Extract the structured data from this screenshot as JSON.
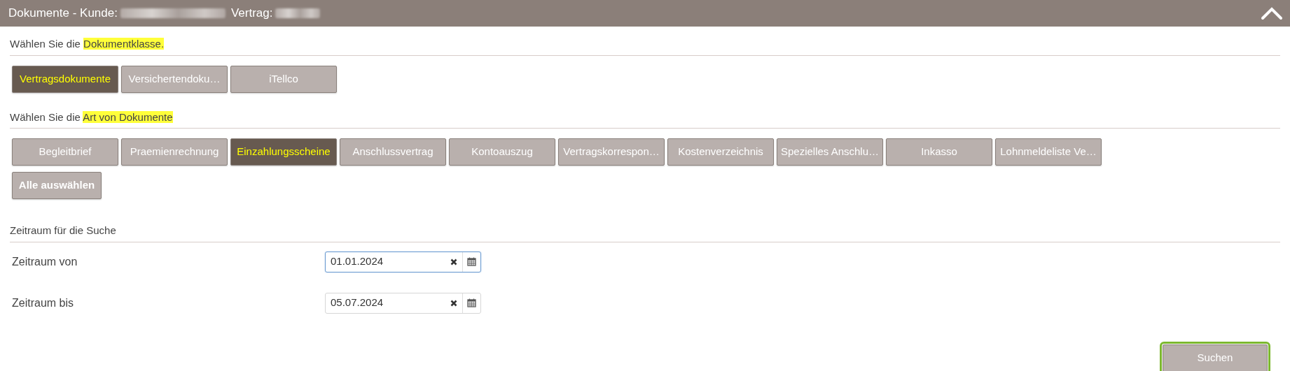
{
  "header": {
    "title_prefix": "Dokumente - Kunde:",
    "contract_label": "Vertrag:",
    "expanded": true
  },
  "document_class": {
    "heading": {
      "text": "Wählen Sie die ",
      "highlight": "Dokumentklasse."
    },
    "buttons": [
      {
        "label": "Vertragsdokumente",
        "selected": true
      },
      {
        "label": "Versichertendoku…",
        "selected": false
      },
      {
        "label": "iTellco",
        "selected": false
      }
    ]
  },
  "document_type": {
    "heading": {
      "text": "Wählen Sie die ",
      "highlight": "Art von Dokumente"
    },
    "buttons": [
      {
        "label": "Begleitbrief",
        "selected": false
      },
      {
        "label": "Praemienrechnung",
        "selected": false
      },
      {
        "label": "Einzahlungsscheine",
        "selected": true
      },
      {
        "label": "Anschlussvertrag",
        "selected": false
      },
      {
        "label": "Kontoauszug",
        "selected": false
      },
      {
        "label": "Vertragskorrespon…",
        "selected": false
      },
      {
        "label": "Kostenverzeichnis",
        "selected": false
      },
      {
        "label": "Spezielles Anschlu…",
        "selected": false
      },
      {
        "label": "Inkasso",
        "selected": false
      },
      {
        "label": "Lohnmeldeliste Ve…",
        "selected": false
      }
    ],
    "select_all": "Alle auswählen"
  },
  "period": {
    "heading": "Zeitraum für die Suche",
    "fields": [
      {
        "label": "Zeitraum von",
        "value": "01.01.2024",
        "focused": true
      },
      {
        "label": "Zeitraum bis",
        "value": "05.07.2024",
        "focused": false
      }
    ]
  },
  "search_button": {
    "label": "Suchen",
    "focused": true
  }
}
